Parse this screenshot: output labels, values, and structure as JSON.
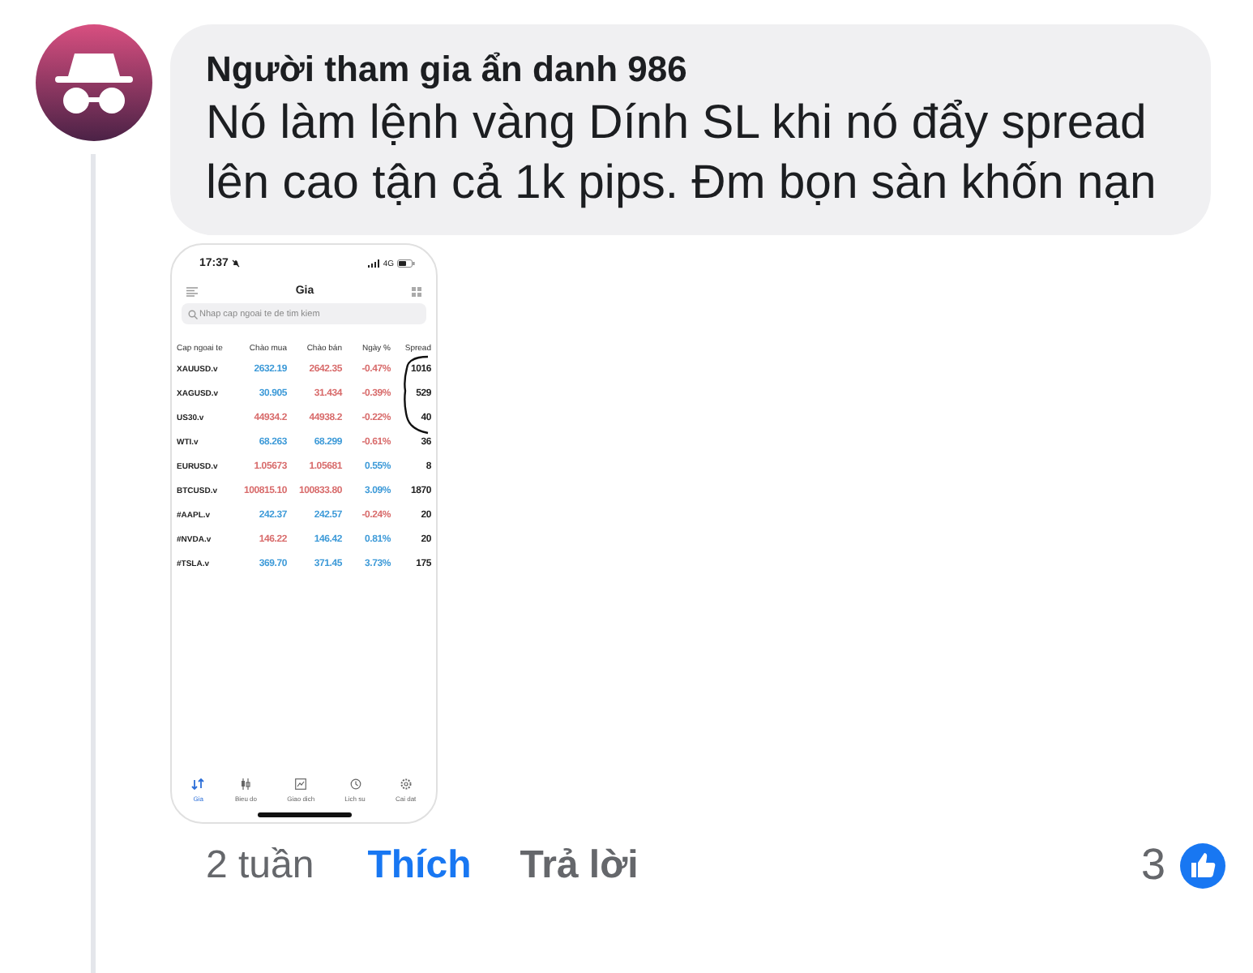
{
  "comment": {
    "author": "Người tham gia ẩn danh 986",
    "text": "Nó làm lệnh vàng Dính SL khi nó đẩy spread lên cao tận cả 1k pips. Đm bọn sàn khốn nạn"
  },
  "screenshot": {
    "status_bar": {
      "time": "17:37",
      "network": "4G"
    },
    "title": "Gia",
    "search": {
      "placeholder": "Nhap cap ngoai te de tim kiem"
    },
    "columns": [
      "Cap ngoai te",
      "Chào mua",
      "Chào bán",
      "Ngày %",
      "Spread"
    ],
    "rows": [
      {
        "symbol": "XAUUSD.v",
        "bid": {
          "value": "2632.19",
          "color": "#3d9ad8"
        },
        "ask": {
          "value": "2642.35",
          "color": "#d86b6b"
        },
        "change": {
          "value": "-0.47%",
          "color": "#d86b6b"
        },
        "spread": "1016"
      },
      {
        "symbol": "XAGUSD.v",
        "bid": {
          "value": "30.905",
          "color": "#3d9ad8"
        },
        "ask": {
          "value": "31.434",
          "color": "#d86b6b"
        },
        "change": {
          "value": "-0.39%",
          "color": "#d86b6b"
        },
        "spread": "529"
      },
      {
        "symbol": "US30.v",
        "bid": {
          "value": "44934.2",
          "color": "#d86b6b"
        },
        "ask": {
          "value": "44938.2",
          "color": "#d86b6b"
        },
        "change": {
          "value": "-0.22%",
          "color": "#d86b6b"
        },
        "spread": "40"
      },
      {
        "symbol": "WTI.v",
        "bid": {
          "value": "68.263",
          "color": "#3d9ad8"
        },
        "ask": {
          "value": "68.299",
          "color": "#3d9ad8"
        },
        "change": {
          "value": "-0.61%",
          "color": "#d86b6b"
        },
        "spread": "36"
      },
      {
        "symbol": "EURUSD.v",
        "bid": {
          "value": "1.05673",
          "color": "#d86b6b"
        },
        "ask": {
          "value": "1.05681",
          "color": "#d86b6b"
        },
        "change": {
          "value": "0.55%",
          "color": "#3d9ad8"
        },
        "spread": "8"
      },
      {
        "symbol": "BTCUSD.v",
        "bid": {
          "value": "100815.10",
          "color": "#d86b6b"
        },
        "ask": {
          "value": "100833.80",
          "color": "#d86b6b"
        },
        "change": {
          "value": "3.09%",
          "color": "#3d9ad8"
        },
        "spread": "1870"
      },
      {
        "symbol": "#AAPL.v",
        "bid": {
          "value": "242.37",
          "color": "#3d9ad8"
        },
        "ask": {
          "value": "242.57",
          "color": "#3d9ad8"
        },
        "change": {
          "value": "-0.24%",
          "color": "#d86b6b"
        },
        "spread": "20"
      },
      {
        "symbol": "#NVDA.v",
        "bid": {
          "value": "146.22",
          "color": "#d86b6b"
        },
        "ask": {
          "value": "146.42",
          "color": "#3d9ad8"
        },
        "change": {
          "value": "0.81%",
          "color": "#3d9ad8"
        },
        "spread": "20"
      },
      {
        "symbol": "#TSLA.v",
        "bid": {
          "value": "369.70",
          "color": "#3d9ad8"
        },
        "ask": {
          "value": "371.45",
          "color": "#3d9ad8"
        },
        "change": {
          "value": "3.73%",
          "color": "#3d9ad8"
        },
        "spread": "175"
      }
    ],
    "tabs": [
      {
        "kind": "quotes",
        "label": "Gia",
        "selected": true
      },
      {
        "kind": "chart",
        "label": "Bieu do",
        "selected": false
      },
      {
        "kind": "trade",
        "label": "Giao dich",
        "selected": false
      },
      {
        "kind": "history",
        "label": "Lich su",
        "selected": false
      },
      {
        "kind": "settings",
        "label": "Cai dat",
        "selected": false
      }
    ]
  },
  "footer": {
    "time": "2 tuần",
    "like": "Thích",
    "reply": "Trả lời",
    "reaction_count": "3"
  }
}
